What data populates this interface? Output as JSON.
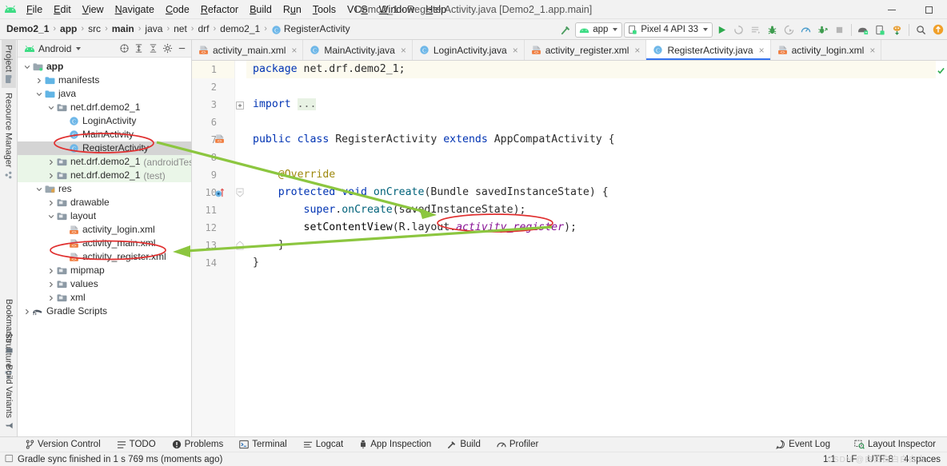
{
  "window": {
    "title": "Demo2_1 - RegisterActivity.java [Demo2_1.app.main]",
    "minimize_label": "Minimize",
    "maximize_label": "Maximize"
  },
  "menubar": {
    "logo": "android-logo-icon",
    "items": [
      {
        "label": "File",
        "mnemonic": "F"
      },
      {
        "label": "Edit",
        "mnemonic": "E"
      },
      {
        "label": "View",
        "mnemonic": "V"
      },
      {
        "label": "Navigate",
        "mnemonic": "N"
      },
      {
        "label": "Code",
        "mnemonic": "C"
      },
      {
        "label": "Refactor",
        "mnemonic": "R"
      },
      {
        "label": "Build",
        "mnemonic": "B"
      },
      {
        "label": "Run",
        "mnemonic": "u"
      },
      {
        "label": "Tools",
        "mnemonic": "T"
      },
      {
        "label": "VCS",
        "mnemonic": "S"
      },
      {
        "label": "Window",
        "mnemonic": "W"
      },
      {
        "label": "Help",
        "mnemonic": "H"
      }
    ]
  },
  "breadcrumbs": [
    {
      "label": "Demo2_1",
      "bold": true,
      "icon": ""
    },
    {
      "label": "app",
      "bold": true,
      "icon": ""
    },
    {
      "label": "src",
      "bold": false,
      "icon": ""
    },
    {
      "label": "main",
      "bold": true,
      "icon": ""
    },
    {
      "label": "java",
      "bold": false,
      "icon": ""
    },
    {
      "label": "net",
      "bold": false,
      "icon": ""
    },
    {
      "label": "drf",
      "bold": false,
      "icon": ""
    },
    {
      "label": "demo2_1",
      "bold": false,
      "icon": ""
    },
    {
      "label": "RegisterActivity",
      "bold": false,
      "icon": "java-class-icon"
    }
  ],
  "toolbar": {
    "build_icon": "hammer-icon",
    "run_config": "app",
    "device": "Pixel 4 API 33",
    "actions": [
      {
        "name": "run-button",
        "glyph": "run"
      },
      {
        "name": "apply-changes-button",
        "glyph": "apply-changes"
      },
      {
        "name": "apply-code-changes-button",
        "glyph": "code-changes"
      },
      {
        "name": "debug-button",
        "glyph": "debug"
      },
      {
        "name": "run-with-coverage-button",
        "glyph": "coverage"
      },
      {
        "name": "profile-button",
        "glyph": "profiler"
      },
      {
        "name": "attach-debugger-button",
        "glyph": "attach"
      },
      {
        "name": "stop-button",
        "glyph": "stop"
      }
    ],
    "actions2": [
      {
        "name": "sdk-manager-button",
        "glyph": "sdk"
      },
      {
        "name": "avd-manager-button",
        "glyph": "avd"
      },
      {
        "name": "sync-gradle-button",
        "glyph": "sync"
      }
    ],
    "search_icon": "search-icon",
    "notification_icon": "update-available-icon"
  },
  "left_strip": {
    "top_tabs": [
      {
        "label": "Project",
        "icon": "project-icon",
        "active": true
      },
      {
        "label": "Resource Manager",
        "icon": "resource-manager-icon",
        "active": false
      }
    ],
    "mid_tabs": [
      {
        "label": "Structure",
        "icon": "structure-icon",
        "active": false
      }
    ],
    "bottom_tabs": [
      {
        "label": "Bookmarks",
        "icon": "bookmarks-icon",
        "active": false
      },
      {
        "label": "Build Variants",
        "icon": "build-variants-icon",
        "active": false
      }
    ]
  },
  "project_panel": {
    "view_mode": "Android",
    "view_icon": "android-head-icon",
    "actions": [
      {
        "name": "select-opened-file-button",
        "icon": "crosshair-icon"
      },
      {
        "name": "expand-all-button",
        "icon": "expand-all-icon"
      },
      {
        "name": "collapse-all-button",
        "icon": "collapse-all-icon"
      },
      {
        "name": "settings-button",
        "icon": "gear-icon"
      },
      {
        "name": "hide-button",
        "icon": "minus-icon"
      }
    ],
    "tree": [
      {
        "label": "app",
        "indent": 0,
        "arrow": "down",
        "icon": "module-icon",
        "bold": true,
        "selected": false
      },
      {
        "label": "manifests",
        "indent": 1,
        "arrow": "right",
        "icon": "folder-icon",
        "bold": false,
        "selected": false
      },
      {
        "label": "java",
        "indent": 1,
        "arrow": "down",
        "icon": "folder-icon",
        "bold": false,
        "selected": false
      },
      {
        "label": "net.drf.demo2_1",
        "indent": 2,
        "arrow": "down",
        "icon": "package-icon",
        "bold": false,
        "selected": false
      },
      {
        "label": "LoginActivity",
        "indent": 3,
        "arrow": "none",
        "icon": "java-class-icon",
        "bold": false,
        "selected": false
      },
      {
        "label": "MainActivity",
        "indent": 3,
        "arrow": "none",
        "icon": "java-class-icon",
        "bold": false,
        "selected": false
      },
      {
        "label": "RegisterActivity",
        "indent": 3,
        "arrow": "none",
        "icon": "java-class-icon",
        "bold": false,
        "selected": true
      },
      {
        "label": "net.drf.demo2_1",
        "suffix": "(androidTest)",
        "indent": 2,
        "arrow": "right",
        "icon": "package-icon",
        "bold": false,
        "selected": false,
        "testhl": true
      },
      {
        "label": "net.drf.demo2_1",
        "suffix": "(test)",
        "indent": 2,
        "arrow": "right",
        "icon": "package-icon",
        "bold": false,
        "selected": false,
        "testhl": true
      },
      {
        "label": "res",
        "indent": 1,
        "arrow": "down",
        "icon": "res-folder-icon",
        "bold": false,
        "selected": false
      },
      {
        "label": "drawable",
        "indent": 2,
        "arrow": "right",
        "icon": "package-icon",
        "bold": false,
        "selected": false
      },
      {
        "label": "layout",
        "indent": 2,
        "arrow": "down",
        "icon": "package-icon",
        "bold": false,
        "selected": false
      },
      {
        "label": "activity_login.xml",
        "indent": 3,
        "arrow": "none",
        "icon": "layout-xml-icon",
        "bold": false,
        "selected": false
      },
      {
        "label": "activity_main.xml",
        "indent": 3,
        "arrow": "none",
        "icon": "layout-xml-icon",
        "bold": false,
        "selected": false
      },
      {
        "label": "activity_register.xml",
        "indent": 3,
        "arrow": "none",
        "icon": "layout-xml-icon",
        "bold": false,
        "selected": false
      },
      {
        "label": "mipmap",
        "indent": 2,
        "arrow": "right",
        "icon": "package-icon",
        "bold": false,
        "selected": false
      },
      {
        "label": "values",
        "indent": 2,
        "arrow": "right",
        "icon": "package-icon",
        "bold": false,
        "selected": false
      },
      {
        "label": "xml",
        "indent": 2,
        "arrow": "right",
        "icon": "package-icon",
        "bold": false,
        "selected": false
      },
      {
        "label": "Gradle Scripts",
        "indent": 0,
        "arrow": "right",
        "icon": "gradle-icon",
        "bold": false,
        "selected": false
      }
    ]
  },
  "editor": {
    "tabs": [
      {
        "label": "activity_main.xml",
        "icon": "layout-xml-icon",
        "active": false
      },
      {
        "label": "MainActivity.java",
        "icon": "java-class-icon",
        "active": false
      },
      {
        "label": "LoginActivity.java",
        "icon": "java-class-icon",
        "active": false
      },
      {
        "label": "activity_register.xml",
        "icon": "layout-xml-icon",
        "active": false
      },
      {
        "label": "RegisterActivity.java",
        "icon": "java-class-icon",
        "active": true
      },
      {
        "label": "activity_login.xml",
        "icon": "layout-xml-icon",
        "active": false
      }
    ],
    "close_glyph": "×",
    "line_numbers": [
      "1",
      "2",
      "3",
      "6",
      "7",
      "8",
      "9",
      "10",
      "11",
      "12",
      "13",
      "14"
    ],
    "code_lines": [
      "package net.drf.demo2_1;",
      "",
      "import ...",
      "",
      "public class RegisterActivity extends AppCompatActivity {",
      "",
      "    @Override",
      "    protected void onCreate(Bundle savedInstanceState) {",
      "        super.onCreate(savedInstanceState);",
      "        setContentView(R.layout.activity_register);",
      "    }",
      "}"
    ],
    "highlighted_symbol": "activity_register",
    "gutter_markers": [
      {
        "line": "7",
        "name": "related-layout-file-marker"
      },
      {
        "line": "10",
        "name": "overridden-method-marker"
      }
    ],
    "inspection_status": "ok"
  },
  "annotations": {
    "ellipses": [
      {
        "name": "register-activity-class-highlight",
        "color": "#e03030"
      },
      {
        "name": "activity-register-xml-highlight",
        "color": "#e03030"
      },
      {
        "name": "set-content-view-arg-highlight",
        "color": "#e03030"
      }
    ],
    "arrows": [
      {
        "name": "arrow-class-to-setcontentview",
        "color": "#8cc63f"
      },
      {
        "name": "arrow-layout-to-xml-file",
        "color": "#8cc63f"
      }
    ]
  },
  "bottom_bar": {
    "items": [
      {
        "label": "Version Control",
        "icon": "branch-icon"
      },
      {
        "label": "TODO",
        "icon": "todo-icon"
      },
      {
        "label": "Problems",
        "icon": "problems-icon"
      },
      {
        "label": "Terminal",
        "icon": "terminal-icon"
      },
      {
        "label": "Logcat",
        "icon": "logcat-icon"
      },
      {
        "label": "App Inspection",
        "icon": "app-inspection-icon"
      },
      {
        "label": "Build",
        "icon": "build-hammer-icon"
      },
      {
        "label": "Profiler",
        "icon": "profiler-icon"
      }
    ],
    "right_items": [
      {
        "label": "Event Log",
        "icon": "event-log-icon"
      },
      {
        "label": "Layout Inspector",
        "icon": "layout-inspector-icon"
      }
    ]
  },
  "status_bar": {
    "message": "Gradle sync finished in 1 s 769 ms (moments ago)",
    "message_icon": "status-square-icon",
    "caret_position": "1:1",
    "line_separator": "LF",
    "encoding": "UTF-8",
    "indent": "4 spaces",
    "watermark": "CSDN @白白白白白白白"
  },
  "colors": {
    "accent_blue": "#3574f0",
    "annotation_red": "#e03030",
    "annotation_green": "#8cc63f",
    "keyword_blue": "#0033b3",
    "field_purple": "#871094",
    "annotation_yellow": "#9e880d",
    "selection_gray": "#d4d4d4"
  }
}
